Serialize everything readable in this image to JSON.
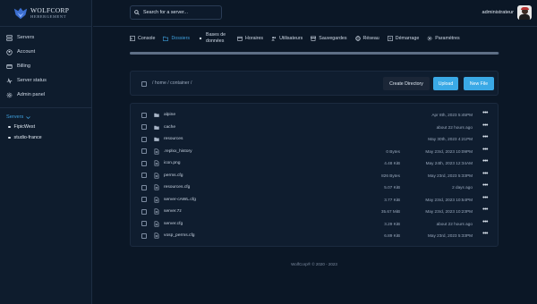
{
  "brand": {
    "line1": "WOLFCORP",
    "line2": "HEBERGEMENT"
  },
  "sidebar": {
    "items": [
      {
        "label": "Servers",
        "icon": "server-icon"
      },
      {
        "label": "Account",
        "icon": "user-icon"
      },
      {
        "label": "Billing",
        "icon": "billing-icon"
      },
      {
        "label": "Server status",
        "icon": "status-icon"
      },
      {
        "label": "Admin panel",
        "icon": "gear-icon"
      }
    ],
    "servers_heading": "Servers",
    "servers": [
      "FipicWest",
      "studio-france"
    ]
  },
  "topbar": {
    "search_placeholder": "Search for a server...",
    "username": "administrateur"
  },
  "tabs": [
    {
      "label": "Console",
      "icon": "terminal-icon",
      "active": false
    },
    {
      "label": "Dossiers",
      "icon": "folder-icon",
      "active": true
    },
    {
      "label": "Bases de données",
      "icon": "database-icon",
      "active": false
    },
    {
      "label": "Horaires",
      "icon": "calendar-icon",
      "active": false
    },
    {
      "label": "Utilisateurs",
      "icon": "users-icon",
      "active": false
    },
    {
      "label": "Sauvegardes",
      "icon": "archive-icon",
      "active": false
    },
    {
      "label": "Réseau",
      "icon": "network-icon",
      "active": false
    },
    {
      "label": "Démarrage",
      "icon": "play-icon",
      "active": false
    },
    {
      "label": "Paramètres",
      "icon": "settings-icon",
      "active": false
    }
  ],
  "pathbar": {
    "path": "/ home / container /",
    "create_directory": "Create Directory",
    "upload": "Upload",
    "new_file": "New File"
  },
  "files": [
    {
      "name": "alpine",
      "type": "folder",
      "size": "",
      "date": "Apr 8th, 2023 5:45PM"
    },
    {
      "name": "cache",
      "type": "folder",
      "size": "",
      "date": "about 22 hours ago"
    },
    {
      "name": "resources",
      "type": "folder",
      "size": "",
      "date": "May 30th, 2023 4:21PM"
    },
    {
      "name": ".replxx_history",
      "type": "file",
      "size": "0 Bytes",
      "date": "May 23rd, 2023 10:09PM"
    },
    {
      "name": "icon.png",
      "type": "file",
      "size": "4.48 KiB",
      "date": "May 24th, 2023 12:34AM"
    },
    {
      "name": "perms.cfg",
      "type": "file",
      "size": "826 Bytes",
      "date": "May 23rd, 2023 5:33PM"
    },
    {
      "name": "resources.cfg",
      "type": "file",
      "size": "5.07 KiB",
      "date": "2 days ago"
    },
    {
      "name": "server-cAWL.cfg",
      "type": "file",
      "size": "3.77 KiB",
      "date": "May 23rd, 2023 10:54PM"
    },
    {
      "name": "server.7z",
      "type": "file",
      "size": "35.67 MiB",
      "date": "May 23rd, 2023 10:23PM"
    },
    {
      "name": "server.cfg",
      "type": "file",
      "size": "3.29 KiB",
      "date": "about 22 hours ago"
    },
    {
      "name": "vosp_perms.cfg",
      "type": "file",
      "size": "6.89 KiB",
      "date": "May 23rd, 2023 5:33PM"
    }
  ],
  "footer": "WolfCorp® © 2020 - 2023",
  "colors": {
    "accent": "#3aa9e6",
    "background": "#0b1726",
    "panel": "#0f1d2f"
  }
}
